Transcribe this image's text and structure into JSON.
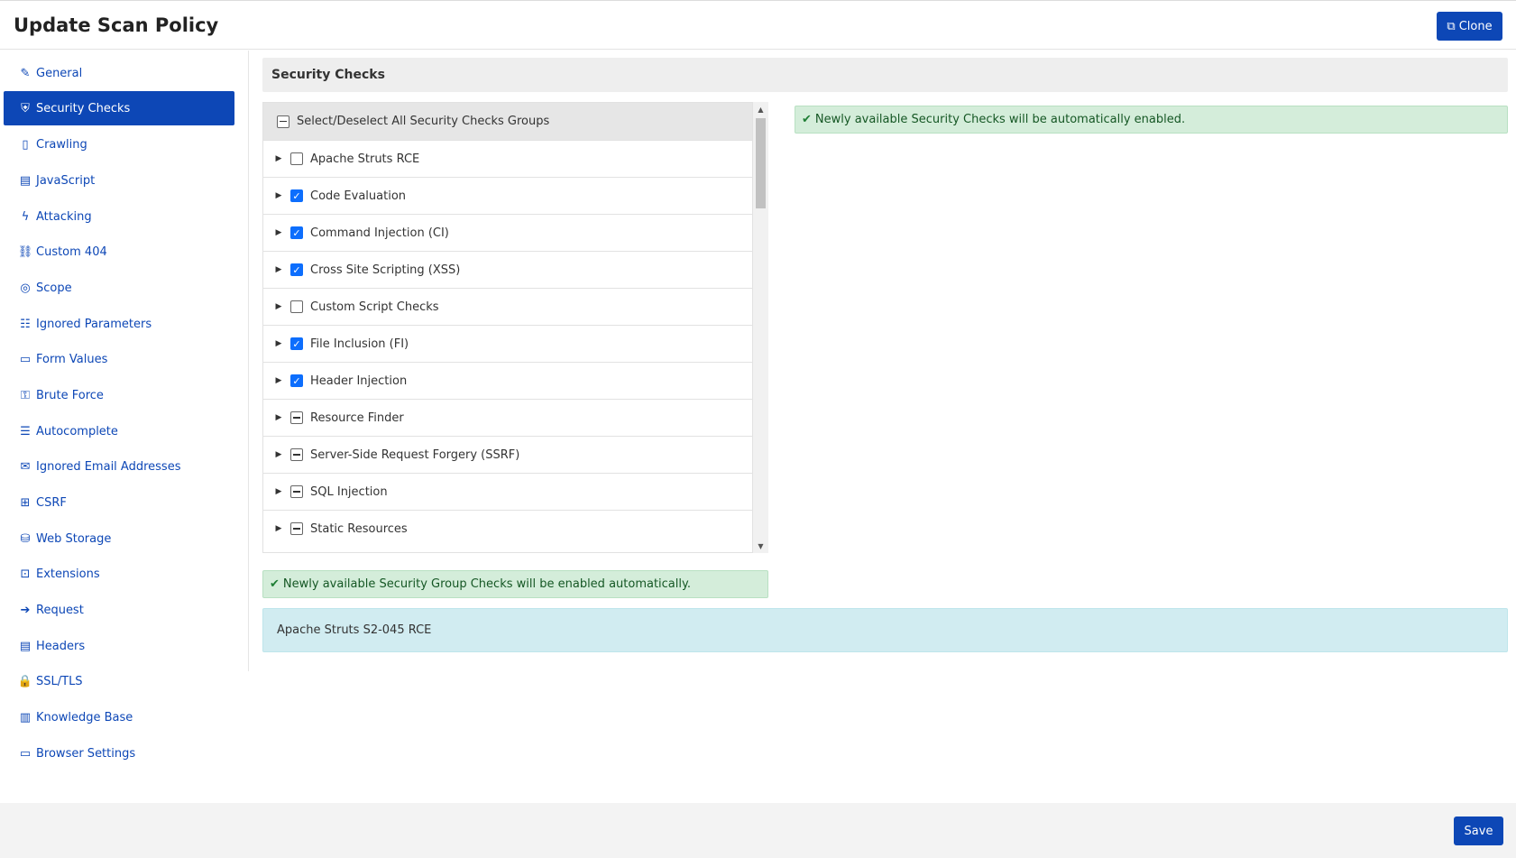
{
  "header": {
    "title": "Update Scan Policy",
    "clone_label": "Clone"
  },
  "sidebar": {
    "items": [
      {
        "label": "General",
        "icon": "edit-icon",
        "glyph": "✎",
        "active": false
      },
      {
        "label": "Security Checks",
        "icon": "shield-icon",
        "glyph": "⛨",
        "active": true
      },
      {
        "label": "Crawling",
        "icon": "file-icon",
        "glyph": "▯",
        "active": false
      },
      {
        "label": "JavaScript",
        "icon": "window-icon",
        "glyph": "▤",
        "active": false
      },
      {
        "label": "Attacking",
        "icon": "bolt-icon",
        "glyph": "ϟ",
        "active": false
      },
      {
        "label": "Custom 404",
        "icon": "link-icon",
        "glyph": "⛓",
        "active": false
      },
      {
        "label": "Scope",
        "icon": "crosshair-icon",
        "glyph": "◎",
        "active": false
      },
      {
        "label": "Ignored Parameters",
        "icon": "list-icon",
        "glyph": "☷",
        "active": false
      },
      {
        "label": "Form Values",
        "icon": "form-icon",
        "glyph": "▭",
        "active": false
      },
      {
        "label": "Brute Force",
        "icon": "lock-icon",
        "glyph": "⚿",
        "active": false
      },
      {
        "label": "Autocomplete",
        "icon": "table-icon",
        "glyph": "☰",
        "active": false
      },
      {
        "label": "Ignored Email Addresses",
        "icon": "envelope-icon",
        "glyph": "✉",
        "active": false
      },
      {
        "label": "CSRF",
        "icon": "sitemap-icon",
        "glyph": "⊞",
        "active": false
      },
      {
        "label": "Web Storage",
        "icon": "storage-icon",
        "glyph": "⛁",
        "active": false
      },
      {
        "label": "Extensions",
        "icon": "extension-icon",
        "glyph": "⊡",
        "active": false
      },
      {
        "label": "Request",
        "icon": "arrow-right-icon",
        "glyph": "➔",
        "active": false
      },
      {
        "label": "Headers",
        "icon": "document-icon",
        "glyph": "▤",
        "active": false
      },
      {
        "label": "SSL/TLS",
        "icon": "padlock-icon",
        "glyph": "🔒",
        "active": false
      },
      {
        "label": "Knowledge Base",
        "icon": "books-icon",
        "glyph": "▥",
        "active": false
      },
      {
        "label": "Browser Settings",
        "icon": "browser-icon",
        "glyph": "▭",
        "active": false
      }
    ]
  },
  "main": {
    "panel_title": "Security Checks",
    "tree": {
      "select_all_label": "Select/Deselect All Security Checks Groups",
      "rows": [
        {
          "label": "Apache Struts RCE",
          "state": "unchecked"
        },
        {
          "label": "Code Evaluation",
          "state": "checked"
        },
        {
          "label": "Command Injection (CI)",
          "state": "checked"
        },
        {
          "label": "Cross Site Scripting (XSS)",
          "state": "checked"
        },
        {
          "label": "Custom Script Checks",
          "state": "unchecked"
        },
        {
          "label": "File Inclusion (FI)",
          "state": "checked"
        },
        {
          "label": "Header Injection",
          "state": "checked"
        },
        {
          "label": "Resource Finder",
          "state": "partial"
        },
        {
          "label": "Server-Side Request Forgery (SSRF)",
          "state": "partial"
        },
        {
          "label": "SQL Injection",
          "state": "partial"
        },
        {
          "label": "Static Resources",
          "state": "partial"
        }
      ]
    },
    "alert_right": "Newly available Security Checks will be automatically enabled.",
    "alert_bottom": "Newly available Security Group Checks will be enabled automatically.",
    "info_text": "Apache Struts S2-045 RCE"
  },
  "footer": {
    "save_label": "Save"
  }
}
